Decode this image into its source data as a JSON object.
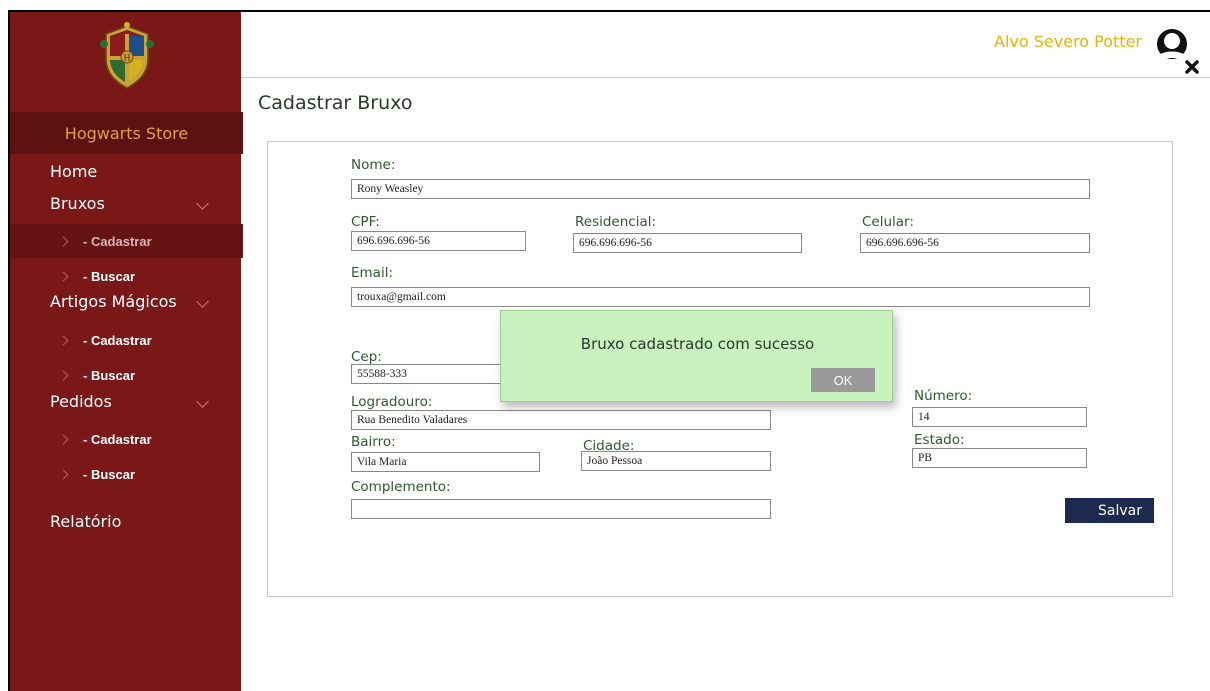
{
  "sidebar": {
    "brand": "Hogwarts Store",
    "home": "Home",
    "bruxos": "Bruxos",
    "bruxos_cadastrar": "- Cadastrar",
    "bruxos_buscar": "- Buscar",
    "artigos": "Artigos Mágicos",
    "artigos_cadastrar": "- Cadastrar",
    "artigos_buscar": "- Buscar",
    "pedidos": "Pedidos",
    "pedidos_cadastrar": "- Cadastrar",
    "pedidos_buscar": "- Buscar",
    "relatorio": "Relatório"
  },
  "header": {
    "username": "Alvo Severo Potter"
  },
  "page": {
    "title": "Cadastrar Bruxo"
  },
  "form": {
    "nome_label": "Nome:",
    "nome_value": "Rony Weasley",
    "cpf_label": "CPF:",
    "cpf_value": "696.696.696-56",
    "residencial_label": "Residencial:",
    "residencial_value": "696.696.696-56",
    "celular_label": "Celular:",
    "celular_value": "696.696.696-56",
    "email_label": "Email:",
    "email_value": "trouxa@gmail.com",
    "cep_label": "Cep:",
    "cep_value": "55588-333",
    "numero_label": "Número:",
    "numero_value": "14",
    "logradouro_label": "Logradouro:",
    "logradouro_value": "Rua Benedito Valadares",
    "bairro_label": "Bairro:",
    "bairro_value": "Vila Maria",
    "cidade_label": "Cidade:",
    "cidade_value": "João Pessoa",
    "estado_label": "Estado:",
    "estado_value": "PB",
    "complemento_label": "Complemento:",
    "complemento_value": "",
    "save_label": "Salvar"
  },
  "dialog": {
    "message": "Bruxo cadastrado com sucesso",
    "ok_label": "OK"
  },
  "colors": {
    "sidebar": "#7a1818",
    "brand_bar": "#5e1111",
    "brand_text": "#d9a441",
    "username": "#e8b400",
    "save_button": "#1d2a4f",
    "dialog_bg": "#c9f2bf",
    "label_text": "#2e5a2e"
  },
  "icons": {
    "crest": "hogwarts-crest-icon",
    "avatar": "user-avatar-icon",
    "logout": "close-x-icon",
    "chevron": "chevron-down-icon",
    "arrow": "chevron-right-icon"
  }
}
